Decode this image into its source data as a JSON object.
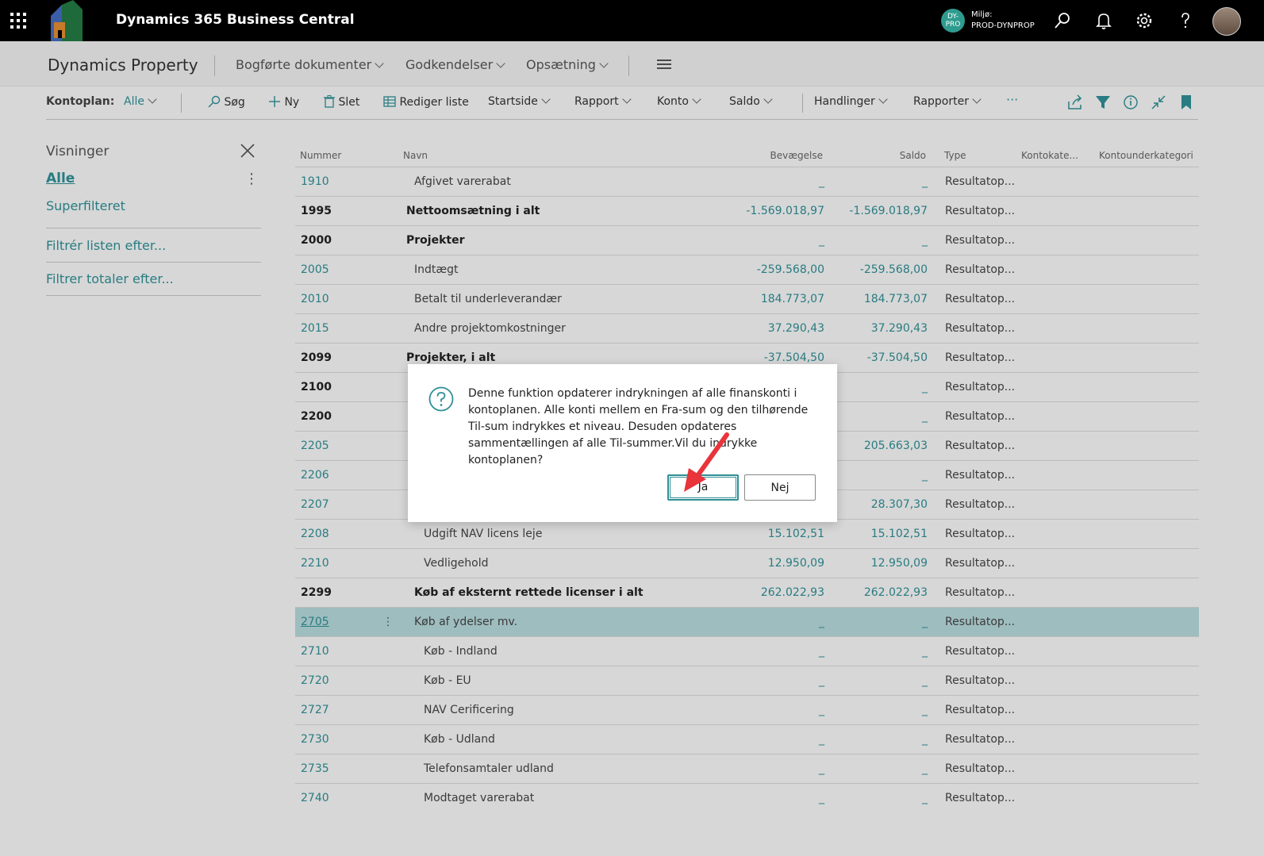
{
  "topbar": {
    "title": "Dynamics 365 Business Central",
    "env_badge": "DY-PRO",
    "env_label": "Miljø:",
    "env_name": "PROD-DYNPROP"
  },
  "navbar": {
    "company": "Dynamics Property",
    "menus": [
      "Bogførte dokumenter",
      "Godkendelser",
      "Opsætning"
    ]
  },
  "actionbar": {
    "kontoplan_label": "Kontoplan:",
    "kontoplan_value": "Alle",
    "sog": "Søg",
    "ny": "Ny",
    "slet": "Slet",
    "rediger": "Rediger liste",
    "startside": "Startside",
    "rapport": "Rapport",
    "konto": "Konto",
    "saldo": "Saldo",
    "handlinger": "Handlinger",
    "rapporter": "Rapporter",
    "more": "···"
  },
  "sidepanel": {
    "title": "Visninger",
    "view_alle": "Alle",
    "view_super": "Superfilteret",
    "filter_list": "Filtrér listen efter...",
    "filter_totals": "Filtrer totaler efter..."
  },
  "grid": {
    "headers": {
      "nummer": "Nummer",
      "navn": "Navn",
      "bevaegelse": "Bevægelse",
      "saldo": "Saldo",
      "type": "Type",
      "kontokategori": "Kontokate...",
      "kontounderkategori": "Kontounderkategori"
    },
    "rows": [
      {
        "nummer": "1910",
        "navn": "Afgivet varerabat",
        "bev": "_",
        "saldo": "_",
        "type": "Resultatop..."
      },
      {
        "nummer": "1995",
        "navn": "Nettoomsætning i alt",
        "bev": "-1.569.018,97",
        "saldo": "-1.569.018,97",
        "type": "Resultatop..."
      },
      {
        "nummer": "2000",
        "navn": "Projekter",
        "bev": "_",
        "saldo": "_",
        "type": "Resultatop..."
      },
      {
        "nummer": "2005",
        "navn": "Indtægt",
        "bev": "-259.568,00",
        "saldo": "-259.568,00",
        "type": "Resultatop..."
      },
      {
        "nummer": "2010",
        "navn": "Betalt til underleverandær",
        "bev": "184.773,07",
        "saldo": "184.773,07",
        "type": "Resultatop..."
      },
      {
        "nummer": "2015",
        "navn": "Andre projektomkostninger",
        "bev": "37.290,43",
        "saldo": "37.290,43",
        "type": "Resultatop..."
      },
      {
        "nummer": "2099",
        "navn": "Projekter, i alt",
        "bev": "-37.504,50",
        "saldo": "-37.504,50",
        "type": "Resultatop..."
      },
      {
        "nummer": "2100",
        "navn": "",
        "bev": "",
        "saldo": "_",
        "type": "Resultatop..."
      },
      {
        "nummer": "2200",
        "navn": "",
        "bev": "",
        "saldo": "_",
        "type": "Resultatop..."
      },
      {
        "nummer": "2205",
        "navn": "",
        "bev": "",
        "saldo": "205.663,03",
        "type": "Resultatop..."
      },
      {
        "nummer": "2206",
        "navn": "",
        "bev": "",
        "saldo": "_",
        "type": "Resultatop..."
      },
      {
        "nummer": "2207",
        "navn": "",
        "bev": "",
        "saldo": "28.307,30",
        "type": "Resultatop..."
      },
      {
        "nummer": "2208",
        "navn": "Udgift NAV licens leje",
        "bev": "15.102,51",
        "saldo": "15.102,51",
        "type": "Resultatop..."
      },
      {
        "nummer": "2210",
        "navn": "Vedligehold",
        "bev": "12.950,09",
        "saldo": "12.950,09",
        "type": "Resultatop..."
      },
      {
        "nummer": "2299",
        "navn": "Køb af eksternt rettede licenser i alt",
        "bev": "262.022,93",
        "saldo": "262.022,93",
        "type": "Resultatop..."
      },
      {
        "nummer": "2705",
        "navn": "Køb af ydelser mv.",
        "bev": "_",
        "saldo": "_",
        "type": "Resultatop..."
      },
      {
        "nummer": "2710",
        "navn": "Køb - Indland",
        "bev": "_",
        "saldo": "_",
        "type": "Resultatop..."
      },
      {
        "nummer": "2720",
        "navn": "Køb - EU",
        "bev": "_",
        "saldo": "_",
        "type": "Resultatop..."
      },
      {
        "nummer": "2727",
        "navn": "NAV Cerificering",
        "bev": "_",
        "saldo": "_",
        "type": "Resultatop..."
      },
      {
        "nummer": "2730",
        "navn": "Køb - Udland",
        "bev": "_",
        "saldo": "_",
        "type": "Resultatop..."
      },
      {
        "nummer": "2735",
        "navn": "Telefonsamtaler udland",
        "bev": "_",
        "saldo": "_",
        "type": "Resultatop..."
      },
      {
        "nummer": "2740",
        "navn": "Modtaget varerabat",
        "bev": "_",
        "saldo": "_",
        "type": "Resultatop..."
      }
    ]
  },
  "dialog": {
    "message": "Denne funktion opdaterer indrykningen af alle finanskonti i kontoplanen. Alle konti mellem en Fra-sum og den tilhørende Til-sum indrykkes et niveau. Desuden opdateres sammentællingen af alle Til-summer.Vil du indrykke kontoplanen?",
    "yes": "Ja",
    "no": "Nej"
  },
  "colors": {
    "accent": "#2f8f96",
    "selected_row": "#b6d9dc",
    "topbar": "#000000",
    "arrow": "#e8343a"
  }
}
